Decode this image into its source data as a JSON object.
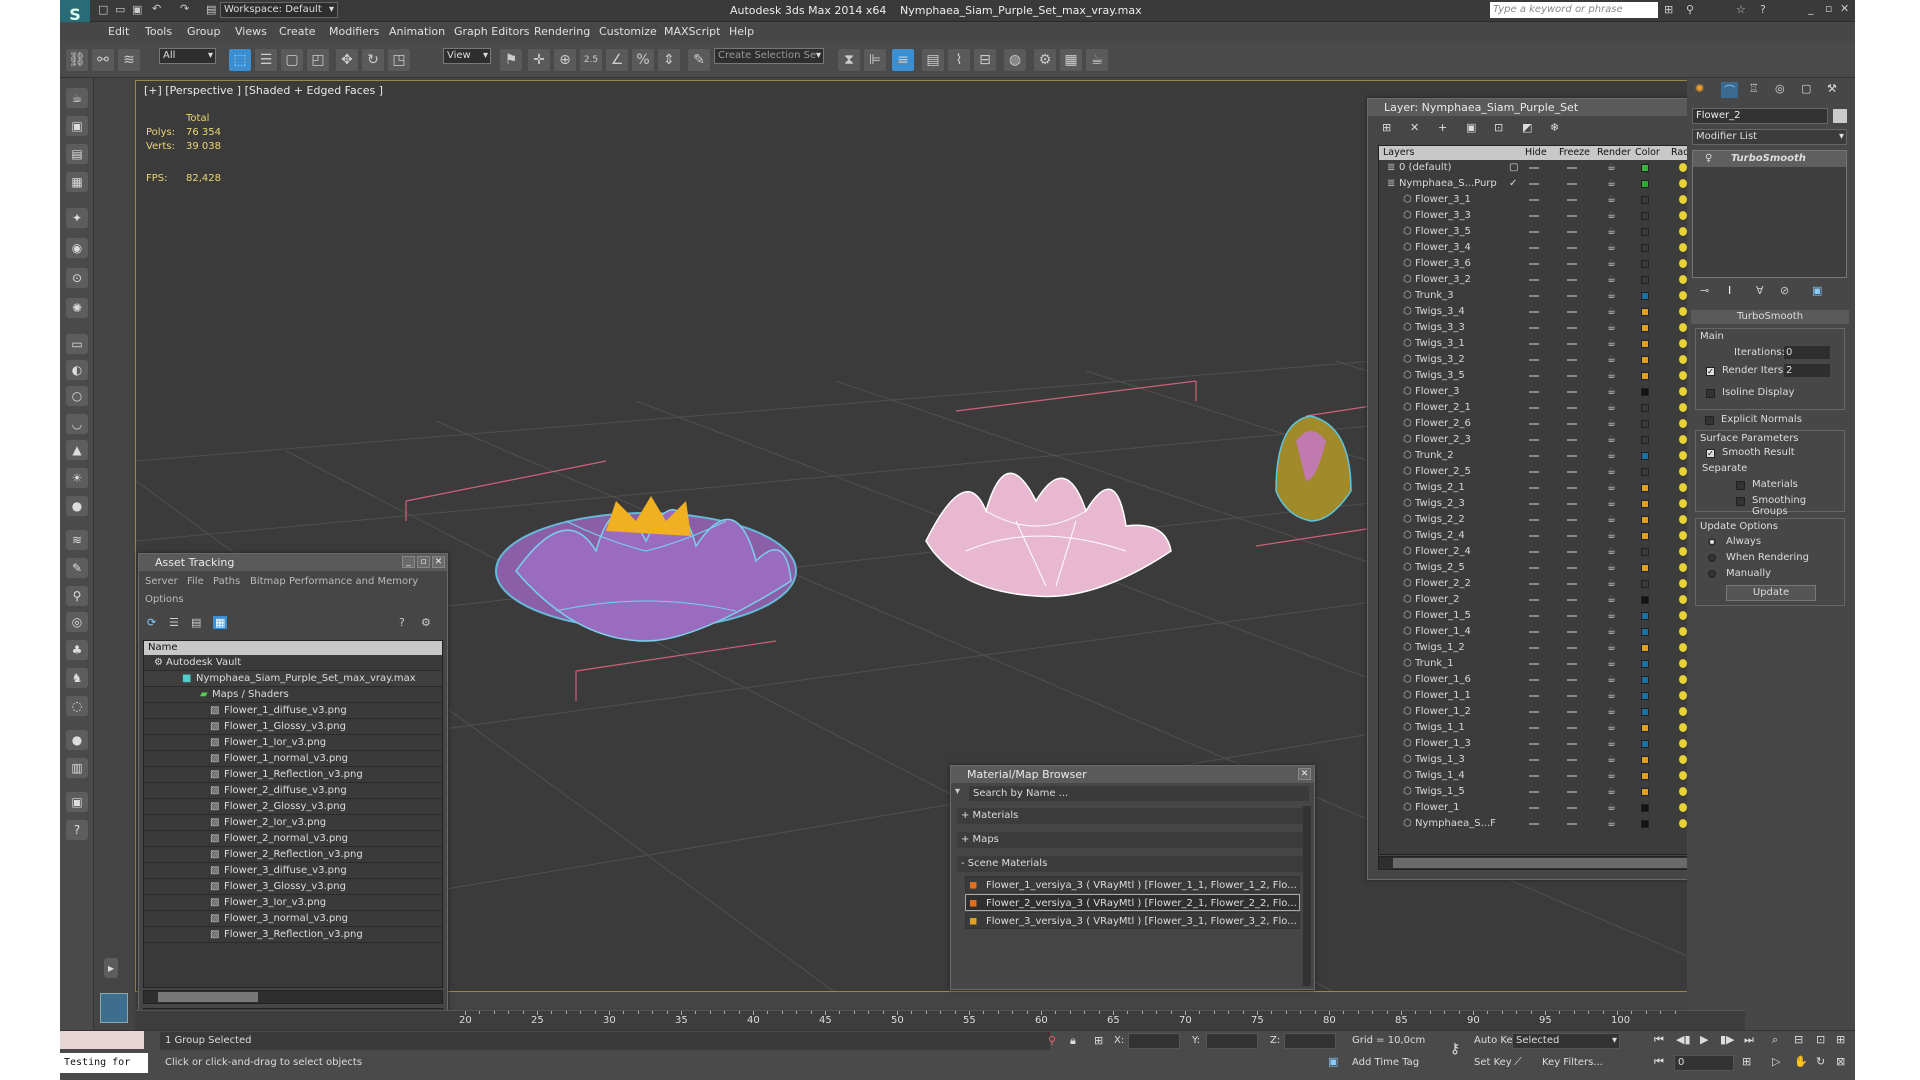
{
  "titlebar": {
    "workspace": "Workspace: Default",
    "app_title": "Autodesk 3ds Max  2014 x64",
    "file_title": "Nymphaea_Siam_Purple_Set_max_vray.max",
    "search_placeholder": "Type a keyword or phrase"
  },
  "menu": [
    "Edit",
    "Tools",
    "Group",
    "Views",
    "Create",
    "Modifiers",
    "Animation",
    "Graph Editors",
    "Rendering",
    "Customize",
    "MAXScript",
    "Help"
  ],
  "toolbar": {
    "filter": "All",
    "ref_coord": "View",
    "selection_set": "Create Selection Se",
    "snap": "2.5",
    "percent": "%"
  },
  "viewport": {
    "label": "[+] [Perspective ] [Shaded + Edged Faces ]",
    "total_label": "Total",
    "polys_label": "Polys:",
    "polys": "76 354",
    "verts_label": "Verts:",
    "verts": "39 038",
    "fps_label": "FPS:",
    "fps": "82,428"
  },
  "asset_tracking": {
    "title": "Asset Tracking",
    "menu": [
      "Server",
      "File",
      "Paths",
      "Bitmap Performance and Memory"
    ],
    "options": "Options",
    "col_name": "Name",
    "vault": "Autodesk Vault",
    "file": "Nymphaea_Siam_Purple_Set_max_vray.max",
    "maps_folder": "Maps / Shaders",
    "maps": [
      "Flower_1_diffuse_v3.png",
      "Flower_1_Glossy_v3.png",
      "Flower_1_Ior_v3.png",
      "Flower_1_normal_v3.png",
      "Flower_1_Reflection_v3.png",
      "Flower_2_diffuse_v3.png",
      "Flower_2_Glossy_v3.png",
      "Flower_2_Ior_v3.png",
      "Flower_2_normal_v3.png",
      "Flower_2_Reflection_v3.png",
      "Flower_3_diffuse_v3.png",
      "Flower_3_Glossy_v3.png",
      "Flower_3_Ior_v3.png",
      "Flower_3_normal_v3.png",
      "Flower_3_Reflection_v3.png"
    ]
  },
  "material_browser": {
    "title": "Material/Map Browser",
    "search_placeholder": "Search by Name ...",
    "materials": "+ Materials",
    "maps": "+ Maps",
    "scene_materials": "- Scene Materials",
    "items": [
      "Flower_1_versiya_3  ( VRayMtl )  [Flower_1_1, Flower_1_2, Flo...",
      "Flower_2_versiya_3  ( VRayMtl )  [Flower_2_1, Flower_2_2, Flo...",
      "Flower_3_versiya_3  ( VRayMtl )  [Flower_3_1, Flower_3_2, Flo..."
    ]
  },
  "layer_window": {
    "title": "Layer: Nymphaea_Siam_Purple_Set",
    "cols": [
      "Layers",
      "Hide",
      "Freeze",
      "Render",
      "Color",
      "Radiosity"
    ],
    "layers": [
      {
        "name": "0 (default)",
        "color": "#3cb43c"
      },
      {
        "name": "Nymphaea_S...Purp",
        "color": "#2ea82e"
      },
      {
        "name": "Flower_3_1",
        "color": "#3a3a3a"
      },
      {
        "name": "Flower_3_3",
        "color": "#3a3a3a"
      },
      {
        "name": "Flower_3_5",
        "color": "#3a3a3a"
      },
      {
        "name": "Flower_3_4",
        "color": "#3a3a3a"
      },
      {
        "name": "Flower_3_6",
        "color": "#3a3a3a"
      },
      {
        "name": "Flower_3_2",
        "color": "#3a3a3a"
      },
      {
        "name": "Trunk_3",
        "color": "#1a6fa0"
      },
      {
        "name": "Twigs_3_4",
        "color": "#e0a020"
      },
      {
        "name": "Twigs_3_3",
        "color": "#e0a020"
      },
      {
        "name": "Twigs_3_1",
        "color": "#e0a020"
      },
      {
        "name": "Twigs_3_2",
        "color": "#e0a020"
      },
      {
        "name": "Twigs_3_5",
        "color": "#e0a020"
      },
      {
        "name": "Flower_3",
        "color": "#111111"
      },
      {
        "name": "Flower_2_1",
        "color": "#3a3a3a"
      },
      {
        "name": "Flower_2_6",
        "color": "#3a3a3a"
      },
      {
        "name": "Flower_2_3",
        "color": "#3a3a3a"
      },
      {
        "name": "Trunk_2",
        "color": "#1a6fa0"
      },
      {
        "name": "Flower_2_5",
        "color": "#3a3a3a"
      },
      {
        "name": "Twigs_2_1",
        "color": "#e0a020"
      },
      {
        "name": "Twigs_2_3",
        "color": "#e0a020"
      },
      {
        "name": "Twigs_2_2",
        "color": "#e0a020"
      },
      {
        "name": "Twigs_2_4",
        "color": "#e0a020"
      },
      {
        "name": "Flower_2_4",
        "color": "#3a3a3a"
      },
      {
        "name": "Twigs_2_5",
        "color": "#e0a020"
      },
      {
        "name": "Flower_2_2",
        "color": "#3a3a3a"
      },
      {
        "name": "Flower_2",
        "color": "#111111"
      },
      {
        "name": "Flower_1_5",
        "color": "#1a6fa0"
      },
      {
        "name": "Flower_1_4",
        "color": "#1a6fa0"
      },
      {
        "name": "Twigs_1_2",
        "color": "#e0a020"
      },
      {
        "name": "Trunk_1",
        "color": "#1a6fa0"
      },
      {
        "name": "Flower_1_6",
        "color": "#1a6fa0"
      },
      {
        "name": "Flower_1_1",
        "color": "#1a6fa0"
      },
      {
        "name": "Flower_1_2",
        "color": "#1a6fa0"
      },
      {
        "name": "Twigs_1_1",
        "color": "#e0a020"
      },
      {
        "name": "Flower_1_3",
        "color": "#1a6fa0"
      },
      {
        "name": "Twigs_1_3",
        "color": "#e0a020"
      },
      {
        "name": "Twigs_1_4",
        "color": "#e0a020"
      },
      {
        "name": "Twigs_1_5",
        "color": "#e0a020"
      },
      {
        "name": "Flower_1",
        "color": "#111111"
      },
      {
        "name": "Nymphaea_S...F",
        "color": "#111111"
      }
    ]
  },
  "command_panel": {
    "object_name": "Flower_2",
    "modifier_list": "Modifier List",
    "modifier": "TurboSmooth",
    "rollout": "TurboSmooth",
    "main": "Main",
    "iterations_label": "Iterations:",
    "iterations": "0",
    "render_iters_label": "Render Iters:",
    "render_iters": "2",
    "isoline": "Isoline Display",
    "explicit": "Explicit Normals",
    "surface": "Surface Parameters",
    "smooth_result": "Smooth Result",
    "separate": "Separate",
    "materials": "Materials",
    "smoothing": "Smoothing Groups",
    "update_options": "Update Options",
    "always": "Always",
    "when_rendering": "When Rendering",
    "manually": "Manually",
    "update_btn": "Update"
  },
  "timeline": {
    "ticks": [
      "20",
      "25",
      "30",
      "35",
      "40",
      "45",
      "50",
      "55",
      "60",
      "65",
      "70",
      "75",
      "80",
      "85",
      "90",
      "95",
      "100"
    ]
  },
  "status": {
    "listener": "Testing for",
    "selected": "1 Group Selected",
    "prompt": "Click or click-and-drag to select objects",
    "x_label": "X:",
    "y_label": "Y:",
    "z_label": "Z:",
    "grid": "Grid = 10,0cm",
    "auto_key": "Auto Key",
    "set_key": "Set Key",
    "key_mode": "Selected",
    "key_filters": "Key Filters...",
    "add_time_tag": "Add Time Tag",
    "frame": "0"
  }
}
